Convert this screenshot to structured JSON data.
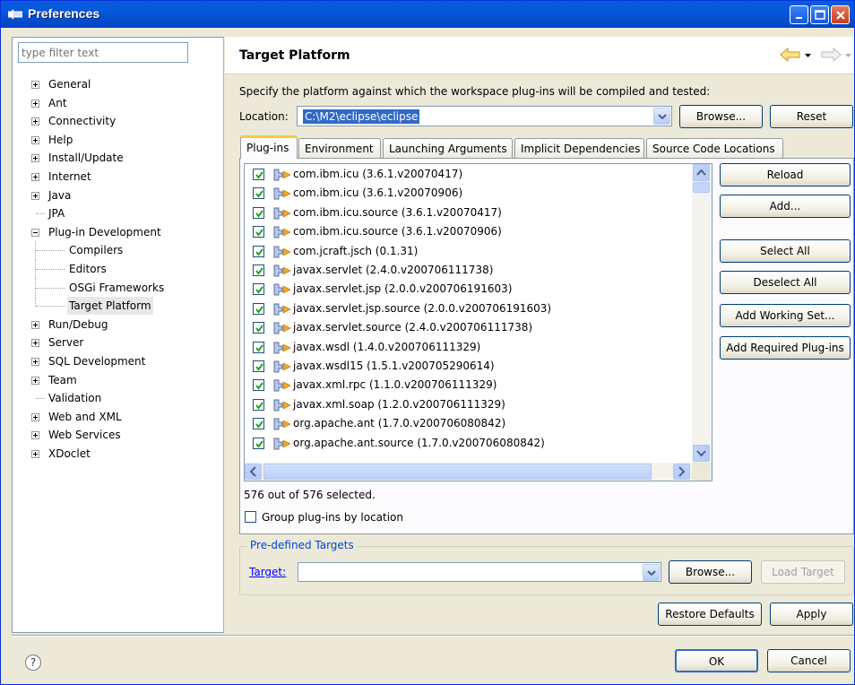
{
  "window": {
    "title": "Preferences"
  },
  "left": {
    "filter_placeholder": "type filter text",
    "tree": [
      {
        "label": "General",
        "level": 0,
        "expander": "plus"
      },
      {
        "label": "Ant",
        "level": 0,
        "expander": "plus"
      },
      {
        "label": "Connectivity",
        "level": 0,
        "expander": "plus"
      },
      {
        "label": "Help",
        "level": 0,
        "expander": "plus"
      },
      {
        "label": "Install/Update",
        "level": 0,
        "expander": "plus"
      },
      {
        "label": "Internet",
        "level": 0,
        "expander": "plus"
      },
      {
        "label": "Java",
        "level": 0,
        "expander": "plus"
      },
      {
        "label": "JPA",
        "level": 0,
        "expander": "none"
      },
      {
        "label": "Plug-in Development",
        "level": 0,
        "expander": "minus"
      },
      {
        "label": "Compilers",
        "level": 1,
        "expander": "none"
      },
      {
        "label": "Editors",
        "level": 1,
        "expander": "none"
      },
      {
        "label": "OSGi Frameworks",
        "level": 1,
        "expander": "none"
      },
      {
        "label": "Target Platform",
        "level": 1,
        "expander": "none",
        "selected": true
      },
      {
        "label": "Run/Debug",
        "level": 0,
        "expander": "plus"
      },
      {
        "label": "Server",
        "level": 0,
        "expander": "plus"
      },
      {
        "label": "SQL Development",
        "level": 0,
        "expander": "plus"
      },
      {
        "label": "Team",
        "level": 0,
        "expander": "plus"
      },
      {
        "label": "Validation",
        "level": 0,
        "expander": "none"
      },
      {
        "label": "Web and XML",
        "level": 0,
        "expander": "plus"
      },
      {
        "label": "Web Services",
        "level": 0,
        "expander": "plus"
      },
      {
        "label": "XDoclet",
        "level": 0,
        "expander": "plus"
      }
    ]
  },
  "page": {
    "title": "Target Platform",
    "description": "Specify the platform against which the workspace plug-ins will be compiled and tested:",
    "location_label": "Location:",
    "location_value": "C:\\M2\\eclipse\\eclipse",
    "browse_label": "Browse...",
    "reset_label": "Reset"
  },
  "tabs": [
    {
      "label": "Plug-ins",
      "active": true
    },
    {
      "label": "Environment"
    },
    {
      "label": "Launching Arguments"
    },
    {
      "label": "Implicit Dependencies"
    },
    {
      "label": "Source Code Locations"
    }
  ],
  "plugins": [
    "com.ibm.icu (3.6.1.v20070417)",
    "com.ibm.icu (3.6.1.v20070906)",
    "com.ibm.icu.source (3.6.1.v20070417)",
    "com.ibm.icu.source (3.6.1.v20070906)",
    "com.jcraft.jsch (0.1.31)",
    "javax.servlet (2.4.0.v200706111738)",
    "javax.servlet.jsp (2.0.0.v200706191603)",
    "javax.servlet.jsp.source (2.0.0.v200706191603)",
    "javax.servlet.source (2.4.0.v200706111738)",
    "javax.wsdl (1.4.0.v200706111329)",
    "javax.wsdl15 (1.5.1.v200705290614)",
    "javax.xml.rpc (1.1.0.v200706111329)",
    "javax.xml.soap (1.2.0.v200706111329)",
    "org.apache.ant (1.7.0.v200706080842)",
    "org.apache.ant.source (1.7.0.v200706080842)"
  ],
  "side_buttons": {
    "reload": "Reload",
    "add": "Add...",
    "select_all": "Select All",
    "deselect_all": "Deselect All",
    "add_working_set": "Add Working Set...",
    "add_required": "Add Required Plug-ins"
  },
  "selection_count": "576 out of 576 selected.",
  "group_by_location": "Group plug-ins by location",
  "predefined": {
    "legend": "Pre-defined Targets",
    "target_label": "Target:",
    "target_value": "",
    "browse_label": "Browse...",
    "load_label": "Load Target"
  },
  "footer": {
    "restore_defaults": "Restore Defaults",
    "apply": "Apply",
    "ok": "OK",
    "cancel": "Cancel",
    "help_glyph": "?"
  },
  "colors": {
    "titlebar": "#0a5be0",
    "selection": "#316ac5",
    "checkmark": "#21a121",
    "link": "#0000ff"
  }
}
